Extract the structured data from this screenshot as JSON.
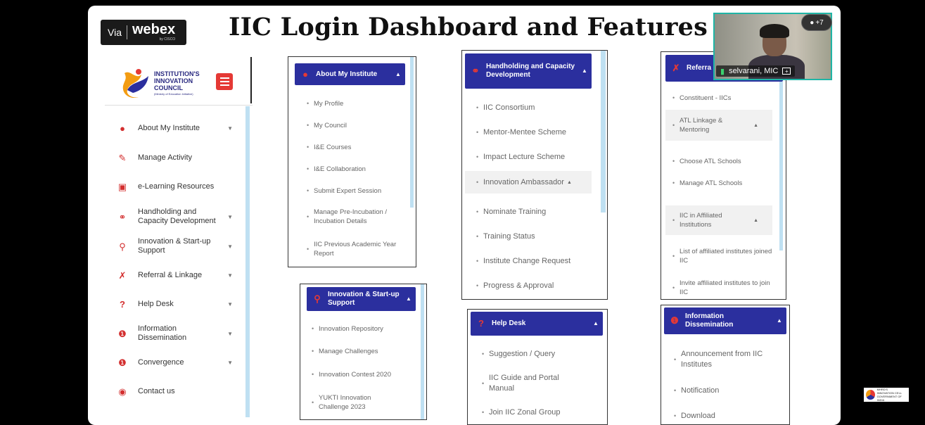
{
  "webex": {
    "via": "Via",
    "brand": "webex",
    "by": "by CISCO"
  },
  "title": "IIC Login Dashboard and Features",
  "logo": {
    "line1": "INSTITUTION'S",
    "line2": "INNOVATION",
    "line3": "COUNCIL",
    "sub": "(Ministry of Education Initiative)"
  },
  "sidebar": {
    "items": [
      {
        "label": "About My Institute",
        "icon": "user-icon"
      },
      {
        "label": "Manage Activity",
        "icon": "edit-icon"
      },
      {
        "label": "e-Learning Resources",
        "icon": "book-icon"
      },
      {
        "label": "Handholding and Capacity Development",
        "icon": "handshake-icon"
      },
      {
        "label": "Innovation & Start-up Support",
        "icon": "lightbulb-icon"
      },
      {
        "label": "Referral & Linkage",
        "icon": "share-icon"
      },
      {
        "label": "Help Desk",
        "icon": "question-icon"
      },
      {
        "label": "Information Dissemination",
        "icon": "info-icon"
      },
      {
        "label": "Convergence",
        "icon": "info-icon"
      },
      {
        "label": "Contact us",
        "icon": "location-pin-icon"
      }
    ]
  },
  "panel_about": {
    "header": "About My Institute",
    "items": [
      "My Profile",
      "My Council",
      "I&E Courses",
      "I&E Collaboration",
      "Submit Expert Session",
      "Manage Pre-Incubation / Incubation Details",
      "IIC Previous Academic Year Report"
    ]
  },
  "panel_innovation": {
    "header": "Innovation & Start-up Support",
    "items": [
      "Innovation Repository",
      "Manage Challenges",
      "Innovation Contest 2020",
      "YUKTI Innovation Challenge 2023"
    ]
  },
  "panel_handholding": {
    "header": "Handholding and Capacity Development",
    "items": [
      "IIC Consortium",
      "Mentor-Mentee Scheme",
      "Impact Lecture Scheme",
      "Innovation Ambassador",
      "Nominate Training",
      "Training Status",
      "Institute Change Request",
      "Progress & Approval"
    ]
  },
  "panel_helpdesk": {
    "header": "Help Desk",
    "items": [
      "Suggestion / Query",
      "IIC Guide and Portal Manual",
      "Join IIC Zonal Group"
    ]
  },
  "panel_referral": {
    "header": "Referra",
    "items": [
      "Constituent - IICs",
      "ATL Linkage & Mentoring",
      "Choose ATL Schools",
      "Manage ATL Schools",
      "IIC in Affiliated Institutions",
      "List of affiliated institutes joined IIC",
      "Invite affiliated institutes to join IIC"
    ]
  },
  "panel_info": {
    "header": "Information Dissemination",
    "items": [
      "Announcement from IIC Institutes",
      "Notification",
      "Download"
    ]
  },
  "video": {
    "name": "selvarani, MIC",
    "participants": "+7"
  },
  "corner_logo": {
    "line1": "MHRD'S",
    "line2": "INNOVATION CELL",
    "line3": "GOVERNMENT OF INDIA"
  },
  "colors": {
    "header_blue": "#2b2f9e",
    "accent_red": "#e53935",
    "scroll_blue": "#bfe0f2",
    "video_border": "#1fb5a6"
  }
}
